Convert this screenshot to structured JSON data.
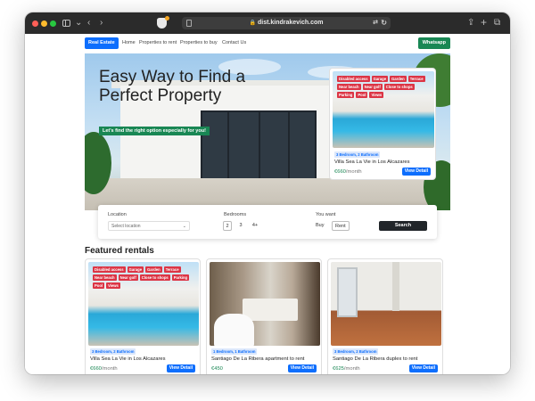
{
  "browser": {
    "url": "dist.kindrakevich.com"
  },
  "navbar": {
    "brand": "Real Estate",
    "links": [
      "Home",
      "Properties to rent",
      "Properties to buy",
      "Contact Us"
    ],
    "whatsapp": "Whatsapp"
  },
  "hero": {
    "title": "Easy Way to Find a Perfect Property",
    "subtitle": "Let's find the right option especially for you!"
  },
  "hero_card": {
    "tags": [
      "Disabled access",
      "Garage",
      "Garden",
      "Terrace",
      "Near beach",
      "Near golf",
      "Close to shops",
      "Parking",
      "Pool",
      "Views"
    ],
    "badge": "3 Bedroom, 2 Bathroom",
    "title": "Villa Sea La Vie in Los Alcazares",
    "price": "€660",
    "price_unit": "/month",
    "button": "View Detail"
  },
  "search": {
    "location_label": "Location",
    "location_placeholder": "Select location",
    "bedrooms_label": "Bedrooms",
    "bedroom_options": [
      "2",
      "3",
      "4+"
    ],
    "bedrooms_selected": "2",
    "want_label": "You want",
    "want_options": [
      "Buy",
      "Rent"
    ],
    "want_selected": "Rent",
    "search_button": "Search"
  },
  "featured": {
    "heading": "Featured rentals",
    "cards": [
      {
        "tags": [
          "Disabled access",
          "Garage",
          "Garden",
          "Terrace",
          "Near beach",
          "Near golf",
          "Close to shops",
          "Parking",
          "Pool",
          "Views"
        ],
        "badge": "3 Bedroom, 2 Bathroom",
        "title": "Villa Sea La Vie in Los Alcazares",
        "price": "€660",
        "price_unit": "/month",
        "button": "View Detail"
      },
      {
        "tags": [],
        "badge": "1 Bedroom, 1 Bathroom",
        "title": "Santiago De La Ribera apartment to rent",
        "price": "€450",
        "price_unit": "",
        "button": "View Detail"
      },
      {
        "tags": [],
        "badge": "3 Bedroom, 2 Bathroom",
        "title": "Santiago De La Ribera duplex to rent",
        "price": "€625",
        "price_unit": "/month",
        "button": "View Detail"
      }
    ]
  },
  "colors": {
    "primary": "#0d6efd",
    "success": "#198754",
    "danger": "#dc3545",
    "dark": "#212529"
  }
}
